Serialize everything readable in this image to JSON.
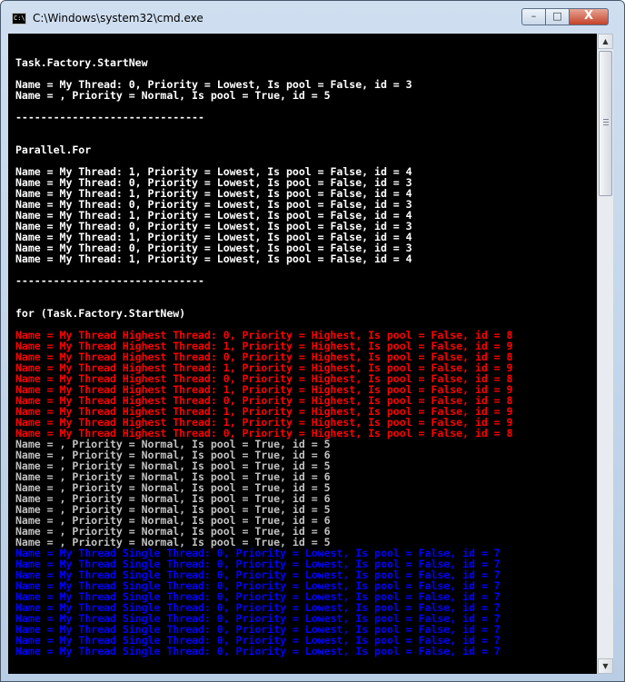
{
  "window": {
    "title": "C:\\Windows\\system32\\cmd.exe",
    "icon_text": "C:\\",
    "controls": {
      "minimize": "–",
      "maximize": "□",
      "close": "X"
    }
  },
  "colors": {
    "console_bg": "#000000",
    "default": "#c0c0c0",
    "white": "#ffffff",
    "red": "#ff0000",
    "blue": "#0000ff"
  },
  "scrollbar": {
    "up_icon": "up-arrow-icon",
    "down_icon": "down-arrow-icon"
  },
  "console": {
    "lines": [
      {
        "text": "",
        "color": "gray"
      },
      {
        "text": "Task.Factory.StartNew",
        "color": "white"
      },
      {
        "text": "",
        "color": "gray"
      },
      {
        "text": "Name = My Thread: 0, Priority = Lowest, Is pool = False, id = 3",
        "color": "white"
      },
      {
        "text": "Name = , Priority = Normal, Is pool = True, id = 5",
        "color": "white"
      },
      {
        "text": "",
        "color": "gray"
      },
      {
        "text": "------------------------------",
        "color": "white"
      },
      {
        "text": "",
        "color": "gray"
      },
      {
        "text": "",
        "color": "gray"
      },
      {
        "text": "Parallel.For",
        "color": "white"
      },
      {
        "text": "",
        "color": "gray"
      },
      {
        "text": "Name = My Thread: 1, Priority = Lowest, Is pool = False, id = 4",
        "color": "white"
      },
      {
        "text": "Name = My Thread: 0, Priority = Lowest, Is pool = False, id = 3",
        "color": "white"
      },
      {
        "text": "Name = My Thread: 1, Priority = Lowest, Is pool = False, id = 4",
        "color": "white"
      },
      {
        "text": "Name = My Thread: 0, Priority = Lowest, Is pool = False, id = 3",
        "color": "white"
      },
      {
        "text": "Name = My Thread: 1, Priority = Lowest, Is pool = False, id = 4",
        "color": "white"
      },
      {
        "text": "Name = My Thread: 0, Priority = Lowest, Is pool = False, id = 3",
        "color": "white"
      },
      {
        "text": "Name = My Thread: 1, Priority = Lowest, Is pool = False, id = 4",
        "color": "white"
      },
      {
        "text": "Name = My Thread: 0, Priority = Lowest, Is pool = False, id = 3",
        "color": "white"
      },
      {
        "text": "Name = My Thread: 1, Priority = Lowest, Is pool = False, id = 4",
        "color": "white"
      },
      {
        "text": "",
        "color": "gray"
      },
      {
        "text": "------------------------------",
        "color": "white"
      },
      {
        "text": "",
        "color": "gray"
      },
      {
        "text": "",
        "color": "gray"
      },
      {
        "text": "for (Task.Factory.StartNew)",
        "color": "white"
      },
      {
        "text": "",
        "color": "gray"
      },
      {
        "text": "Name = My Thread Highest Thread: 0, Priority = Highest, Is pool = False, id = 8",
        "color": "red"
      },
      {
        "text": "Name = My Thread Highest Thread: 1, Priority = Highest, Is pool = False, id = 9",
        "color": "red"
      },
      {
        "text": "Name = My Thread Highest Thread: 0, Priority = Highest, Is pool = False, id = 8",
        "color": "red"
      },
      {
        "text": "Name = My Thread Highest Thread: 1, Priority = Highest, Is pool = False, id = 9",
        "color": "red"
      },
      {
        "text": "Name = My Thread Highest Thread: 0, Priority = Highest, Is pool = False, id = 8",
        "color": "red"
      },
      {
        "text": "Name = My Thread Highest Thread: 1, Priority = Highest, Is pool = False, id = 9",
        "color": "red"
      },
      {
        "text": "Name = My Thread Highest Thread: 0, Priority = Highest, Is pool = False, id = 8",
        "color": "red"
      },
      {
        "text": "Name = My Thread Highest Thread: 1, Priority = Highest, Is pool = False, id = 9",
        "color": "red"
      },
      {
        "text": "Name = My Thread Highest Thread: 1, Priority = Highest, Is pool = False, id = 9",
        "color": "red"
      },
      {
        "text": "Name = My Thread Highest Thread: 0, Priority = Highest, Is pool = False, id = 8",
        "color": "red"
      },
      {
        "text": "Name = , Priority = Normal, Is pool = True, id = 5",
        "color": "gray"
      },
      {
        "text": "Name = , Priority = Normal, Is pool = True, id = 6",
        "color": "gray"
      },
      {
        "text": "Name = , Priority = Normal, Is pool = True, id = 5",
        "color": "gray"
      },
      {
        "text": "Name = , Priority = Normal, Is pool = True, id = 6",
        "color": "gray"
      },
      {
        "text": "Name = , Priority = Normal, Is pool = True, id = 5",
        "color": "gray"
      },
      {
        "text": "Name = , Priority = Normal, Is pool = True, id = 6",
        "color": "gray"
      },
      {
        "text": "Name = , Priority = Normal, Is pool = True, id = 5",
        "color": "gray"
      },
      {
        "text": "Name = , Priority = Normal, Is pool = True, id = 6",
        "color": "gray"
      },
      {
        "text": "Name = , Priority = Normal, Is pool = True, id = 6",
        "color": "gray"
      },
      {
        "text": "Name = , Priority = Normal, Is pool = True, id = 5",
        "color": "gray"
      },
      {
        "text": "Name = My Thread Single Thread: 0, Priority = Lowest, Is pool = False, id = 7",
        "color": "blue"
      },
      {
        "text": "Name = My Thread Single Thread: 0, Priority = Lowest, Is pool = False, id = 7",
        "color": "blue"
      },
      {
        "text": "Name = My Thread Single Thread: 0, Priority = Lowest, Is pool = False, id = 7",
        "color": "blue"
      },
      {
        "text": "Name = My Thread Single Thread: 0, Priority = Lowest, Is pool = False, id = 7",
        "color": "blue"
      },
      {
        "text": "Name = My Thread Single Thread: 0, Priority = Lowest, Is pool = False, id = 7",
        "color": "blue"
      },
      {
        "text": "Name = My Thread Single Thread: 0, Priority = Lowest, Is pool = False, id = 7",
        "color": "blue"
      },
      {
        "text": "Name = My Thread Single Thread: 0, Priority = Lowest, Is pool = False, id = 7",
        "color": "blue"
      },
      {
        "text": "Name = My Thread Single Thread: 0, Priority = Lowest, Is pool = False, id = 7",
        "color": "blue"
      },
      {
        "text": "Name = My Thread Single Thread: 0, Priority = Lowest, Is pool = False, id = 7",
        "color": "blue"
      },
      {
        "text": "Name = My Thread Single Thread: 0, Priority = Lowest, Is pool = False, id = 7",
        "color": "blue"
      }
    ]
  }
}
